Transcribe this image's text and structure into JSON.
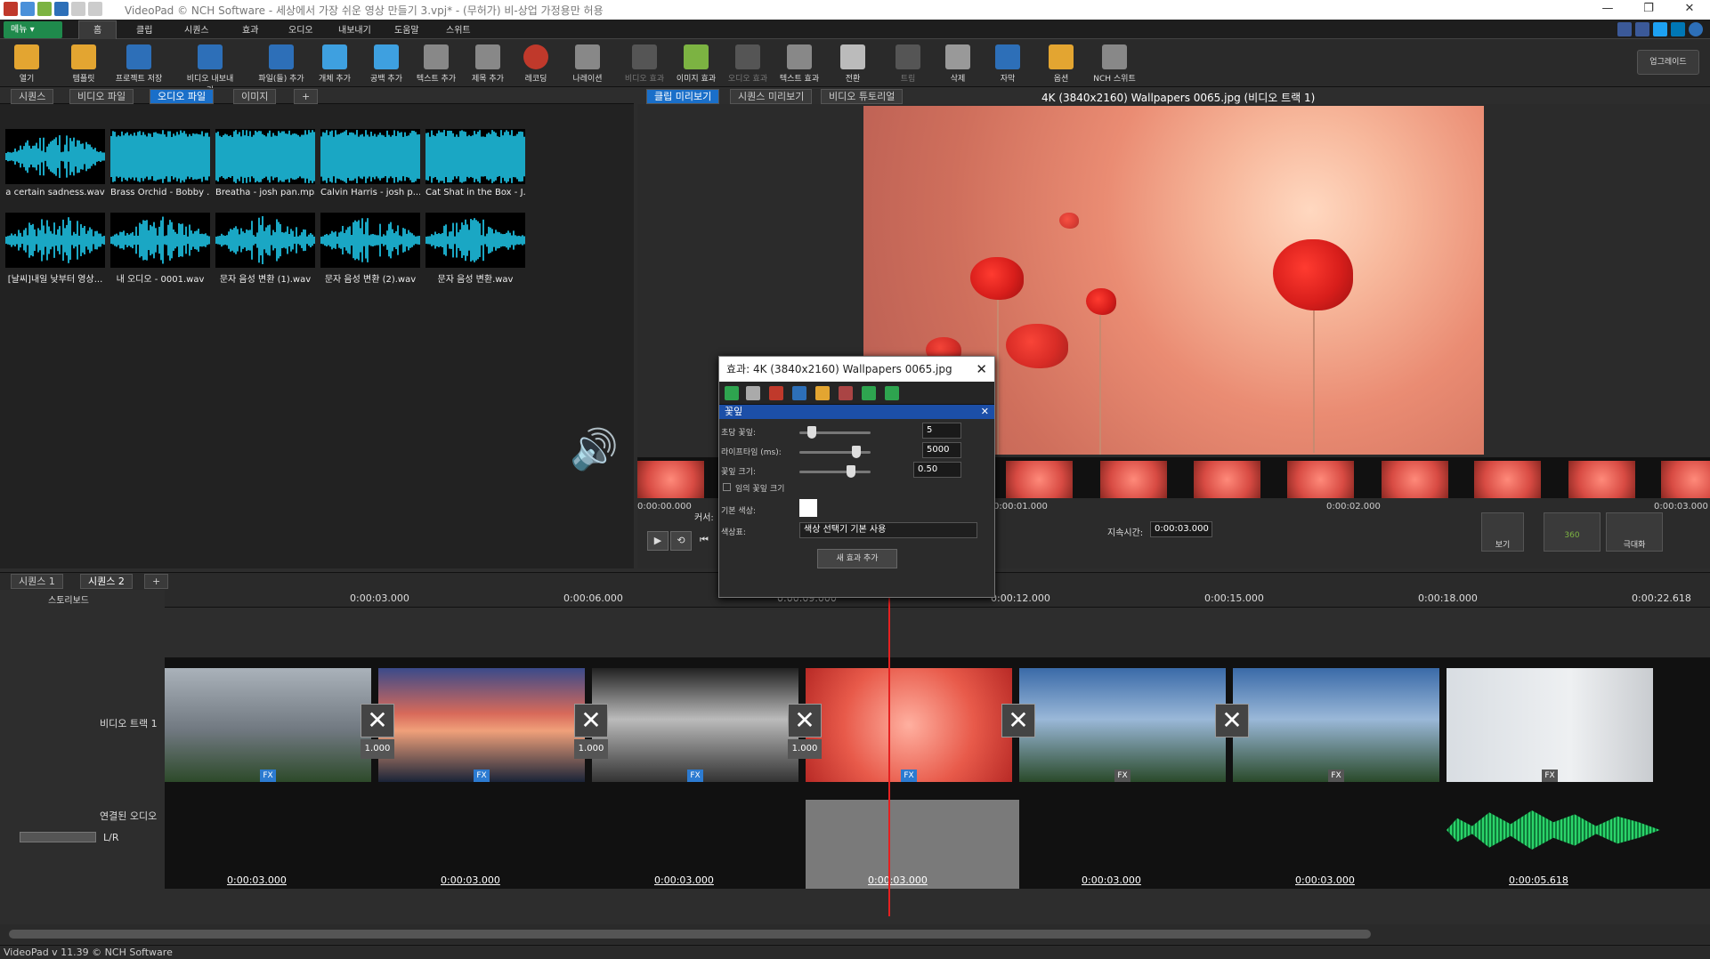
{
  "window": {
    "title": "VideoPad © NCH Software - 세상에서 가장 쉬운 영상 만들기 3.vpj* - (무허가) 비-상업 가정용만 허용"
  },
  "menu": {
    "menu_button": "메뉴 ▾",
    "tabs": [
      "홈",
      "클립",
      "시퀀스",
      "효과",
      "오디오",
      "내보내기",
      "도움말",
      "스위트"
    ]
  },
  "toolbar": {
    "buttons": [
      "열기",
      "템플릿",
      "프로젝트 저장",
      "비디오 내보내기",
      "파일(들) 추가",
      "개체 추가",
      "공백 추가",
      "텍스트 추가",
      "제목 추가",
      "레코딩",
      "나레이션",
      "비디오 효과",
      "이미지 효과",
      "오디오 효과",
      "텍스트 효과",
      "전환",
      "트림",
      "삭제",
      "자막",
      "옵션",
      "NCH 스위트"
    ],
    "upgrade": "업그레이드"
  },
  "bin": {
    "tabs": [
      "시퀀스",
      "비디오 파일",
      "오디오 파일",
      "이미지"
    ],
    "active_tab": "오디오 파일",
    "files": [
      "a certain sadness.wav",
      "Brass Orchid - Bobby ...",
      "Breatha - josh pan.mp3",
      "Calvin Harris - josh p...",
      "Cat Shat in the Box - J...",
      "[날씨]내일 낮부터 영상...",
      "내 오디오 - 0001.wav",
      "문자 음성 변환 (1).wav",
      "문자 음성 변환 (2).wav",
      "문자 음성 변환.wav"
    ]
  },
  "preview": {
    "tabs": [
      "클립 미리보기",
      "시퀀스 미리보기",
      "비디오 튜토리얼"
    ],
    "title": "4K (3840x2160) Wallpapers 0065.jpg (비디오 트랙 1)",
    "times": [
      "0:00:00.000",
      "0:00:01.000",
      "0:00:02.000",
      "0:00:03.000"
    ],
    "cursor_label": "커서:",
    "duration_label": "지속시간:",
    "duration_value": "0:00:03.000",
    "view_label": "보기",
    "zoom_label": "360",
    "maximize_label": "극대화"
  },
  "effects": {
    "title": "효과: 4K (3840x2160) Wallpapers 0065.jpg",
    "section": "꽃잎",
    "rows": [
      {
        "label": "초당 꽃잎:",
        "value": "5"
      },
      {
        "label": "라이프타임 (ms):",
        "value": "5000"
      },
      {
        "label": "꽃잎 크기:",
        "value": "0.50"
      }
    ],
    "random_size": "임의 꽃잎 크기",
    "base_color_label": "기본 색상:",
    "palette_label": "색상표:",
    "palette_value": "색상 선택기 기본 사용",
    "add_button": "새 효과 추가"
  },
  "timeline": {
    "tabs": [
      "시퀀스 1",
      "시퀀스 2"
    ],
    "storyboard": "스토리보드",
    "ruler": [
      "0:00:03.000",
      "0:00:06.000",
      "0:00:09.000",
      "0:00:12.000",
      "0:00:15.000",
      "0:00:18.000",
      "0:00:22.618"
    ],
    "video_track": "비디오 트랙 1",
    "audio_track": "연결된 오디오",
    "lr_label": "L/R",
    "transition_value": "1.000",
    "durations": [
      "0:00:03.000",
      "0:00:03.000",
      "0:00:03.000",
      "0:00:03.000",
      "0:00:03.000",
      "0:00:03.000",
      "0:00:05.618"
    ],
    "fx": "FX"
  },
  "status": {
    "text": "VideoPad v 11.39 © NCH Software"
  }
}
